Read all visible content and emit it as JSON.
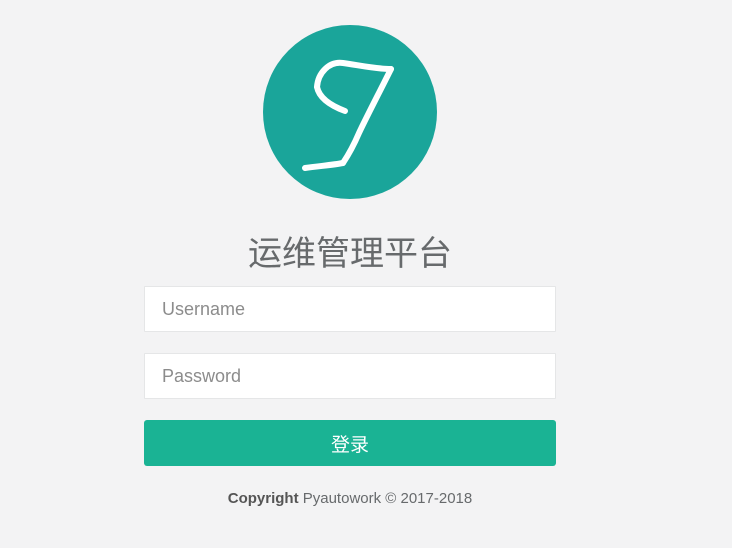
{
  "logo": {
    "icon": "stylized-letter-logo",
    "background": "#1aa59a",
    "stroke": "#ffffff"
  },
  "page": {
    "title": "运维管理平台"
  },
  "form": {
    "username_placeholder": "Username",
    "username_value": "",
    "password_placeholder": "Password",
    "password_value": "",
    "submit_label": "登录",
    "submit_color": "#1ab394"
  },
  "footer": {
    "copyright_label": "Copyright",
    "copyright_text": " Pyautowork © 2017-2018"
  }
}
